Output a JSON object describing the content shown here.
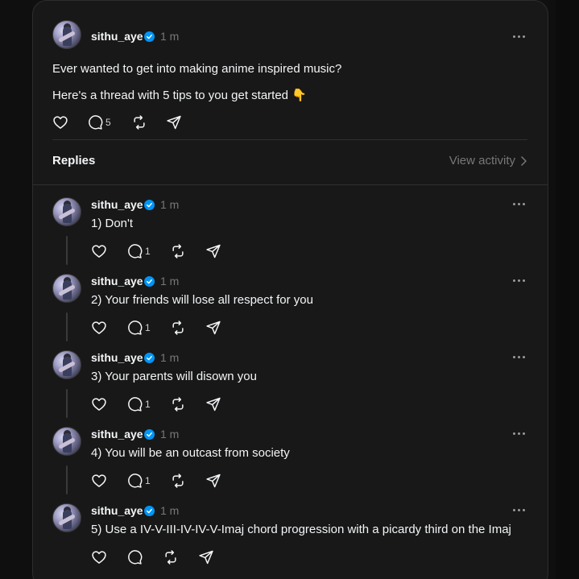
{
  "post": {
    "username": "sithu_aye",
    "time": "1 m",
    "line1": "Ever wanted to get into making anime inspired music?",
    "line2": "Here's a thread with 5 tips to you get started 👇",
    "reply_count": "5"
  },
  "replies_section": {
    "label": "Replies",
    "view_activity": "View activity"
  },
  "replies": [
    {
      "username": "sithu_aye",
      "time": "1 m",
      "text": "1) Don't",
      "reply_count": "1"
    },
    {
      "username": "sithu_aye",
      "time": "1 m",
      "text": "2) Your friends will lose all respect for you",
      "reply_count": "1"
    },
    {
      "username": "sithu_aye",
      "time": "1 m",
      "text": "3) Your parents will disown you",
      "reply_count": "1"
    },
    {
      "username": "sithu_aye",
      "time": "1 m",
      "text": "4) You will be an outcast from society",
      "reply_count": "1"
    },
    {
      "username": "sithu_aye",
      "time": "1 m",
      "text": "5) Use a IV-V-III-IV-IV-V-Imaj chord progression with a picardy third on the Imaj",
      "reply_count": ""
    }
  ],
  "colors": {
    "background": "#101010",
    "card": "#181818",
    "verified": "#0095f6",
    "muted": "#777777"
  },
  "icons": [
    "heart-icon",
    "comment-icon",
    "repost-icon",
    "share-icon",
    "more-icon",
    "verified-badge-icon",
    "chevron-right-icon"
  ]
}
